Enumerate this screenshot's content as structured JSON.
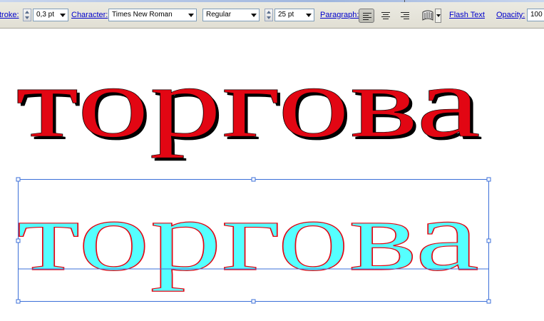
{
  "toolbar": {
    "stroke_label": "troke:",
    "stroke_value": "0,3 pt",
    "character_label": "Character:",
    "font_family": "Times New Roman",
    "font_style": "Regular",
    "font_size": "25 pt",
    "paragraph_label": "Paragraph:",
    "flash_text_label": "Flash Text",
    "opacity_label": "Opacity:",
    "opacity_value": "100"
  },
  "canvas": {
    "word_top": "торгова",
    "word_bottom": "торгова",
    "colors": {
      "top_fill": "#e20613",
      "top_shadow": "#000000",
      "bottom_fill": "#55ffff",
      "bottom_stroke": "#e20613",
      "selection": "#3b6fd8"
    }
  }
}
